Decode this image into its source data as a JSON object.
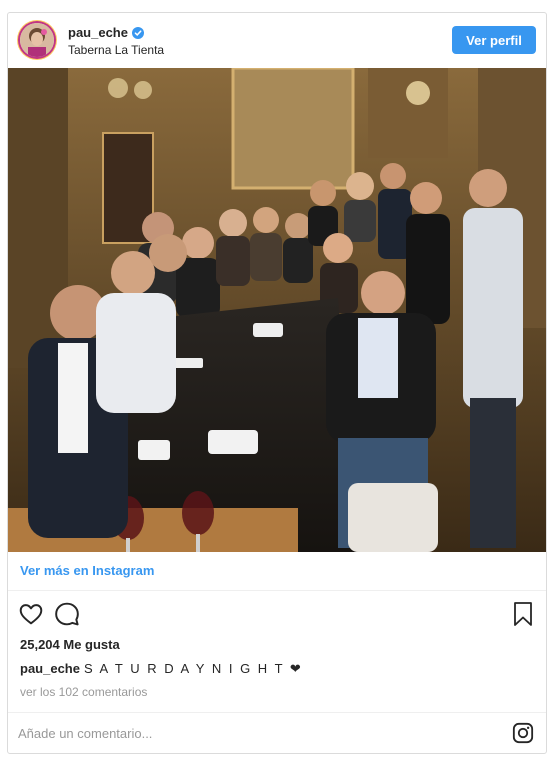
{
  "post": {
    "username": "pau_eche",
    "location": "Taberna La Tienta",
    "view_profile_label": "Ver perfil",
    "view_more_label": "Ver más en Instagram",
    "likes_text": "25,204 Me gusta",
    "caption_user": "pau_eche",
    "caption_text": "S A T U R D A Y N I G H T ❤",
    "comments_link": "ver los 102 comentarios",
    "comment_placeholder": "Añade un comentario...",
    "photo_description_icon": "group-photo"
  },
  "colors": {
    "accent": "#3897f0",
    "text": "#262626",
    "muted": "#999999",
    "border": "#dbdbdb"
  }
}
